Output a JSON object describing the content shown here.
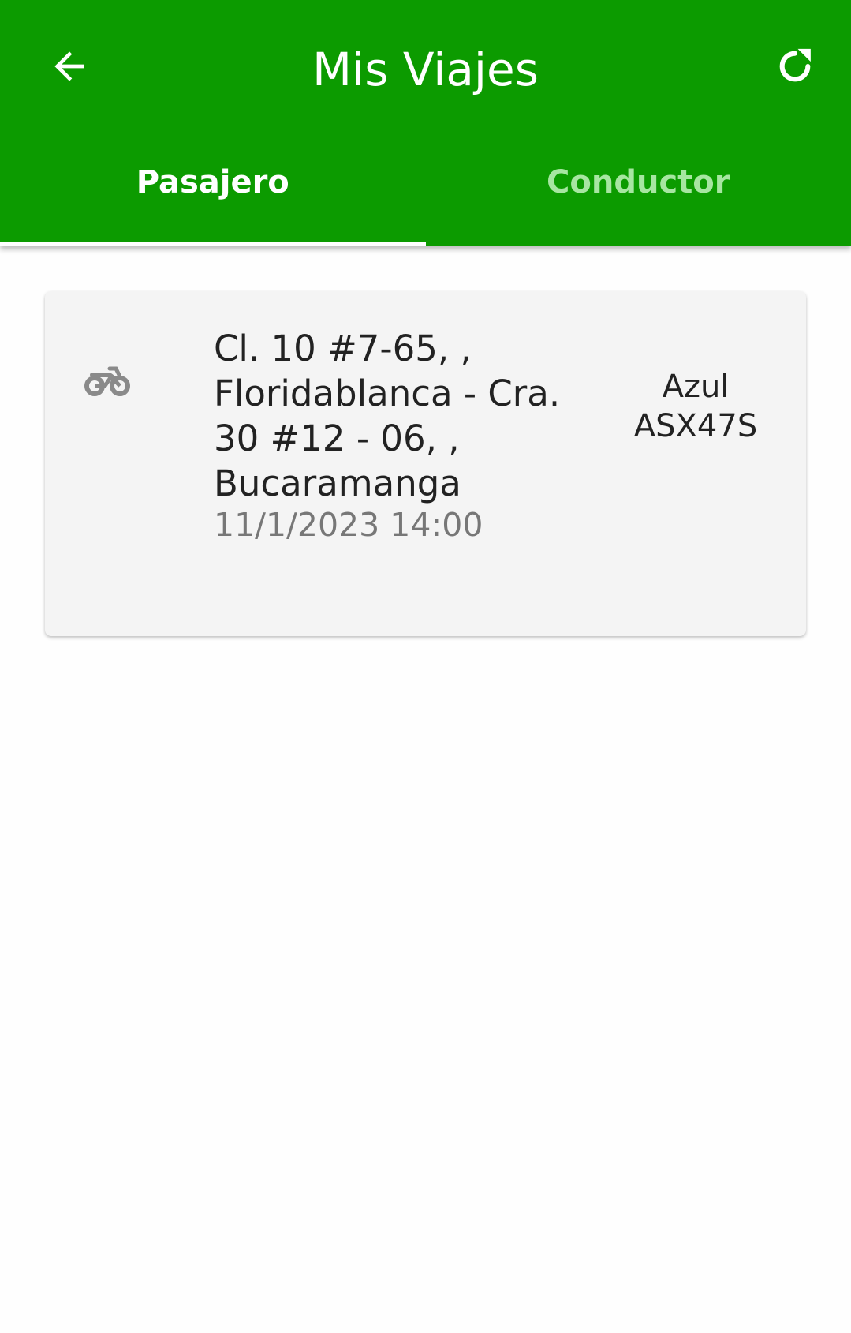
{
  "header": {
    "title": "Mis Viajes",
    "back_icon": "arrow-left-icon",
    "refresh_icon": "refresh-icon"
  },
  "tabs": [
    {
      "label": "Pasajero",
      "active": true
    },
    {
      "label": "Conductor",
      "active": false
    }
  ],
  "trips": [
    {
      "vehicle_icon": "motorcycle-icon",
      "route": "Cl. 10 #7-65, , Floridablanca - Cra. 30 #12 - 06, , Bucaramanga",
      "datetime": "11/1/2023 14:00",
      "color": "Azul",
      "plate": "ASX47S"
    }
  ],
  "colors": {
    "primary": "#0c9b00",
    "tab_inactive_text": "#a7e6a1",
    "card_background": "#f4f4f4",
    "secondary_text": "#777777",
    "icon_gray": "#8a8a8a"
  }
}
